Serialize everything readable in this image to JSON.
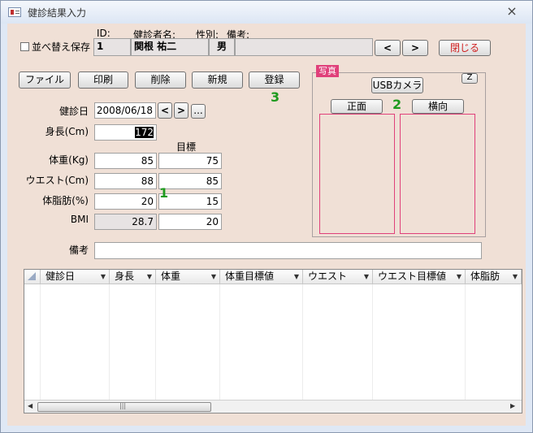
{
  "window": {
    "title": "健診結果入力",
    "close_glyph": "×"
  },
  "header": {
    "id_label": "ID:",
    "id_value": "1",
    "name_label": "健診者名:",
    "name_value": "関根 祐二",
    "gender_label": "性別:",
    "gender_value": "男",
    "note_label": "備考:",
    "note_value": "",
    "sort_save_label": "並べ替え保存",
    "prev_glyph": "<",
    "next_glyph": ">",
    "close_button": "閉じる"
  },
  "toolbar": {
    "file": "ファイル",
    "print": "印刷",
    "delete": "削除",
    "new": "新規",
    "register": "登録"
  },
  "markers": {
    "one": "1",
    "two": "2",
    "three": "3"
  },
  "form": {
    "date_label": "健診日",
    "date_value": "2008/06/18",
    "date_prev": "<",
    "date_next": ">",
    "date_picker": "...",
    "target_label": "目標",
    "height_label": "身長(Cm)",
    "height_value": "172",
    "weight_label": "体重(Kg)",
    "weight_value": "85",
    "weight_target": "75",
    "waist_label": "ウエスト(Cm)",
    "waist_value": "88",
    "waist_target": "85",
    "bodyfat_label": "体脂肪(%)",
    "bodyfat_value": "20",
    "bodyfat_target": "15",
    "bmi_label": "BMI",
    "bmi_value": "28.7",
    "bmi_target": "20",
    "remarks_label": "備考",
    "remarks_value": ""
  },
  "photo": {
    "title": "写真",
    "usb_camera": "USBカメラ",
    "z_button": "Z",
    "front": "正面",
    "side": "横向"
  },
  "grid": {
    "columns": [
      "健診日",
      "身長",
      "体重",
      "体重目標値",
      "ウエスト",
      "ウエスト目標値",
      "体脂肪"
    ],
    "scroll_glyph": "|||"
  },
  "colors": {
    "form_bg": "#f0e0d6",
    "photo_accent": "#e0407a",
    "marker_green": "#1e9a1e"
  }
}
